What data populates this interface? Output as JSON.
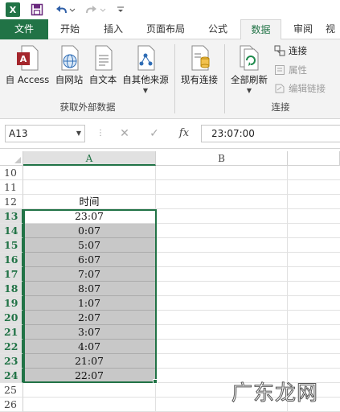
{
  "quick_access": {
    "app_icon": "excel-logo",
    "app_letter": "X",
    "save_icon": "save-icon",
    "undo_icon": "undo-icon",
    "redo_icon": "redo-icon",
    "customize_icon": "customize-arrow-icon"
  },
  "tabs": [
    {
      "label": "文件"
    },
    {
      "label": "开始"
    },
    {
      "label": "插入"
    },
    {
      "label": "页面布局"
    },
    {
      "label": "公式"
    },
    {
      "label": "数据"
    },
    {
      "label": "审阅"
    },
    {
      "label": "视"
    }
  ],
  "active_tab": "数据",
  "ribbon": {
    "get_external": {
      "group_label": "获取外部数据",
      "buttons": [
        {
          "label": "自 Access",
          "icon": "access-db-icon"
        },
        {
          "label": "自网站",
          "icon": "web-page-icon"
        },
        {
          "label": "自文本",
          "icon": "text-file-icon"
        },
        {
          "label": "自其他来源",
          "icon": "other-sources-icon"
        }
      ]
    },
    "existing": {
      "label": "现有连接",
      "icon": "existing-connections-icon"
    },
    "connections": {
      "group_label": "连接",
      "refresh_all": {
        "label": "全部刷新",
        "icon": "refresh-all-icon"
      },
      "items": [
        {
          "label": "连接",
          "icon": "connections-icon",
          "enabled": true
        },
        {
          "label": "属性",
          "icon": "properties-icon",
          "enabled": false
        },
        {
          "label": "编辑链接",
          "icon": "edit-links-icon",
          "enabled": false
        }
      ]
    }
  },
  "formula_bar": {
    "name_box": "A13",
    "cancel": "✕",
    "enter": "✓",
    "fx": "fx",
    "value": "23:07:00"
  },
  "columns": [
    "A",
    "B"
  ],
  "selected_column": "A",
  "rows": [
    {
      "num": "10",
      "a": ""
    },
    {
      "num": "11",
      "a": ""
    },
    {
      "num": "12",
      "a": "时间"
    },
    {
      "num": "13",
      "a": "23:07"
    },
    {
      "num": "14",
      "a": "0:07"
    },
    {
      "num": "15",
      "a": "5:07"
    },
    {
      "num": "16",
      "a": "6:07"
    },
    {
      "num": "17",
      "a": "7:07"
    },
    {
      "num": "18",
      "a": "8:07"
    },
    {
      "num": "19",
      "a": "1:07"
    },
    {
      "num": "20",
      "a": "2:07"
    },
    {
      "num": "21",
      "a": "3:07"
    },
    {
      "num": "22",
      "a": "4:07"
    },
    {
      "num": "23",
      "a": "21:07"
    },
    {
      "num": "24",
      "a": "22:07"
    },
    {
      "num": "25",
      "a": ""
    },
    {
      "num": "26",
      "a": ""
    }
  ],
  "watermark": "广东龙网",
  "colors": {
    "excel_green": "#217346",
    "selection_fill": "#c8c8c8",
    "ribbon_bg": "#f3f3f3"
  }
}
